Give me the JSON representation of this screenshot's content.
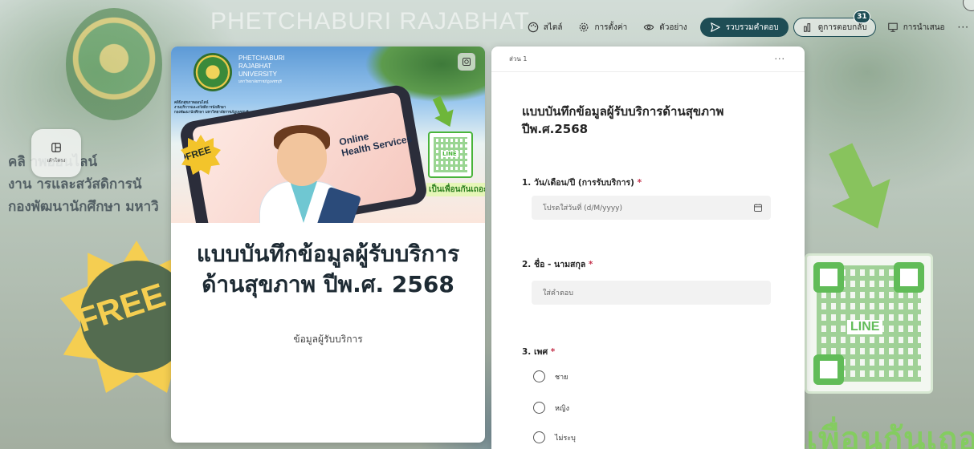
{
  "background": {
    "university_name": "PHETCHABURI RAJABHAT",
    "side_text_line1": "คลิ  าพออนไลน์",
    "side_text_line2": "งาน  ารและสวัสดิการนั",
    "side_text_line3": "กองพัฒนานักศึกษา มหาวิ",
    "free": "FREE",
    "qr_line": "LINE",
    "bottom_text": "เป็นเพื่อนกันเถอะ"
  },
  "toolbar": {
    "style_label": "สไตล์",
    "settings_label": "การตั้งค่า",
    "preview_label": "ตัวอย่าง",
    "collect_label": "รวบรวมคำตอบ",
    "responses_label": "ดูการตอบกลับ",
    "responses_count": "31",
    "present_label": "การนำเสนอ",
    "more": "···"
  },
  "layout_toggle": {
    "label": "เค้าโครง"
  },
  "cover": {
    "image": {
      "uni_line1": "PHETCHABURI",
      "uni_line2": "RAJABHAT",
      "uni_line3": "UNIVERSITY",
      "uni_thai": "มหาวิทยาลัยราชภัฏเพชรบุรี",
      "dept_line1": "คลินิกสุขภาพออนไลน์",
      "dept_line2": "งานบริการและสวัสดิการนักศึกษา",
      "dept_line3": "กองพัฒนานักศึกษา มหาวิทยาลัยราชภัฏเพชรบุรี",
      "health_line1": "Online",
      "health_line2": "Health Services",
      "free": "FREE",
      "qr_line": "LINE",
      "banner": "เป็นเพื่อนกันเถอะ"
    },
    "title": "แบบบันทึกข้อมูลผู้รับบริการด้านสุขภาพ ปีพ.ศ. 2568",
    "subtitle": "ข้อมูลผู้รับบริการ"
  },
  "form": {
    "section_label": "ส่วน 1",
    "more": "···",
    "title": "แบบบันทึกข้อมูลผู้รับบริการด้านสุขภาพ ปีพ.ศ.2568",
    "questions": [
      {
        "label": "1. วัน/เดือน/ปี (การรับบริการ)",
        "required": "*",
        "placeholder": "โปรดใส่วันที่ (d/M/yyyy)"
      },
      {
        "label": "2. ชื่อ - นามสกุล",
        "required": "*",
        "placeholder": "ใส่คำตอบ"
      },
      {
        "label": "3. เพศ",
        "required": "*",
        "options": [
          "ชาย",
          "หญิง",
          "ไม่ระบุ"
        ]
      }
    ]
  },
  "colors": {
    "accent": "#1e4d55",
    "required": "#c4314b"
  }
}
